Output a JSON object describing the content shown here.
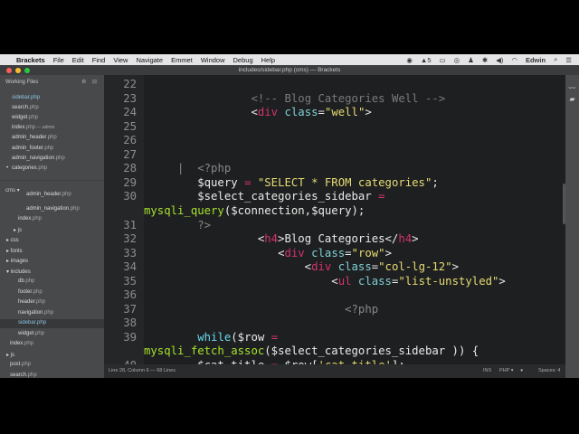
{
  "menubar": {
    "app": "Brackets",
    "items": [
      "File",
      "Edit",
      "Find",
      "View",
      "Navigate",
      "Emmet",
      "Window",
      "Debug",
      "Help"
    ],
    "right": {
      "badge": "5",
      "user": "Edwin"
    }
  },
  "titlebar": {
    "title": "includes/sidebar.php (cms) — Brackets"
  },
  "sidebar": {
    "working_files_label": "Working Files",
    "working_files": [
      [
        "sidebar",
        ".php",
        ""
      ],
      [
        "search",
        ".php",
        ""
      ],
      [
        "widget",
        ".php",
        ""
      ],
      [
        "index",
        ".php",
        " — admin"
      ],
      [
        "admin_header",
        ".php",
        ""
      ],
      [
        "admin_footer",
        ".php",
        ""
      ],
      [
        "admin_navigation",
        ".php",
        ""
      ],
      [
        "categories",
        ".php",
        ""
      ]
    ],
    "project_label": "cms ▾",
    "tree": [
      [
        "admin_header",
        ".php"
      ],
      [
        "admin_navigation",
        ".php"
      ],
      [
        "index",
        ".php"
      ],
      [
        "▸ js",
        ""
      ],
      [
        "▸ css",
        ""
      ],
      [
        "▸ fonts",
        ""
      ],
      [
        "▸ images",
        ""
      ],
      [
        "▾ includes",
        ""
      ],
      [
        "db",
        ".php"
      ],
      [
        "footer",
        ".php"
      ],
      [
        "header",
        ".php"
      ],
      [
        "navigation",
        ".php"
      ],
      [
        "sidebar",
        ".php"
      ],
      [
        "widget",
        ".php"
      ],
      [
        "index",
        ".php"
      ],
      [
        "▸ js",
        ""
      ],
      [
        "post",
        ".php"
      ],
      [
        "search",
        ".php"
      ]
    ]
  },
  "editor": {
    "rows": [
      {
        "ln": "22",
        "tokens": []
      },
      {
        "ln": "23",
        "tokens": [
          [
            "                ",
            ""
          ],
          [
            "<!-- Blog Categories Well -->",
            "c"
          ]
        ]
      },
      {
        "ln": "24",
        "tokens": [
          [
            "                <",
            ""
          ],
          [
            "div",
            "t"
          ],
          [
            " ",
            ""
          ],
          [
            "class",
            "a"
          ],
          [
            "=",
            ""
          ],
          [
            "\"well\"",
            "s"
          ],
          [
            ">",
            ""
          ]
        ]
      },
      {
        "ln": "25",
        "tokens": []
      },
      {
        "ln": "26",
        "tokens": []
      },
      {
        "ln": "27",
        "tokens": []
      },
      {
        "ln": "28",
        "tokens": [
          [
            "     |  ",
            "p"
          ],
          [
            "<?php",
            "p"
          ]
        ]
      },
      {
        "ln": "29",
        "tokens": [
          [
            "        $query ",
            ""
          ],
          [
            "=",
            "o"
          ],
          [
            " ",
            ""
          ],
          [
            "\"SELECT * FROM categories\"",
            "s"
          ],
          [
            ";",
            ""
          ]
        ]
      },
      {
        "ln": "30",
        "tokens": [
          [
            "        $select_categories_sidebar ",
            ""
          ],
          [
            "=",
            "o"
          ]
        ]
      },
      {
        "ln": "",
        "tokens": [
          [
            "mysqli_query",
            "f"
          ],
          [
            "($connection,$query);",
            ""
          ]
        ]
      },
      {
        "ln": "31",
        "tokens": [
          [
            "        ",
            ""
          ],
          [
            "?>",
            "p"
          ]
        ]
      },
      {
        "ln": "32",
        "tokens": [
          [
            "                 <",
            ""
          ],
          [
            "h4",
            "t"
          ],
          [
            ">Blog Categories</",
            ""
          ],
          [
            "h4",
            "t"
          ],
          [
            ">",
            ""
          ]
        ]
      },
      {
        "ln": "33",
        "tokens": [
          [
            "                    <",
            ""
          ],
          [
            "div",
            "t"
          ],
          [
            " ",
            ""
          ],
          [
            "class",
            "a"
          ],
          [
            "=",
            ""
          ],
          [
            "\"row\"",
            "s"
          ],
          [
            ">",
            ""
          ]
        ]
      },
      {
        "ln": "34",
        "tokens": [
          [
            "                        <",
            ""
          ],
          [
            "div",
            "t"
          ],
          [
            " ",
            ""
          ],
          [
            "class",
            "a"
          ],
          [
            "=",
            ""
          ],
          [
            "\"col-lg-12\"",
            "s"
          ],
          [
            ">",
            ""
          ]
        ]
      },
      {
        "ln": "35",
        "tokens": [
          [
            "                            <",
            ""
          ],
          [
            "ul",
            "t"
          ],
          [
            " ",
            ""
          ],
          [
            "class",
            "a"
          ],
          [
            "=",
            ""
          ],
          [
            "\"list-unstyled\"",
            "s"
          ],
          [
            ">",
            ""
          ]
        ]
      },
      {
        "ln": "36",
        "tokens": []
      },
      {
        "ln": "37",
        "tokens": [
          [
            "                              ",
            ""
          ],
          [
            "<?php",
            "p"
          ]
        ]
      },
      {
        "ln": "38",
        "tokens": []
      },
      {
        "ln": "39",
        "tokens": [
          [
            "        ",
            ""
          ],
          [
            "while",
            "w"
          ],
          [
            "($row ",
            ""
          ],
          [
            "=",
            "o"
          ]
        ]
      },
      {
        "ln": "",
        "tokens": [
          [
            "mysqli_fetch_assoc",
            "f"
          ],
          [
            "($select_categories_sidebar )) {",
            ""
          ]
        ]
      },
      {
        "ln": "40",
        "tokens": [
          [
            "        $cat_title ",
            ""
          ],
          [
            "=",
            "o"
          ],
          [
            " $row[",
            ""
          ],
          [
            "'cat_title'",
            "s"
          ],
          [
            "];",
            ""
          ]
        ]
      }
    ]
  },
  "status": {
    "position": "Line 28, Column 6 — 68 Lines",
    "mode": "INS",
    "language": "PHP ▾",
    "spaces": "Spaces: 4"
  }
}
